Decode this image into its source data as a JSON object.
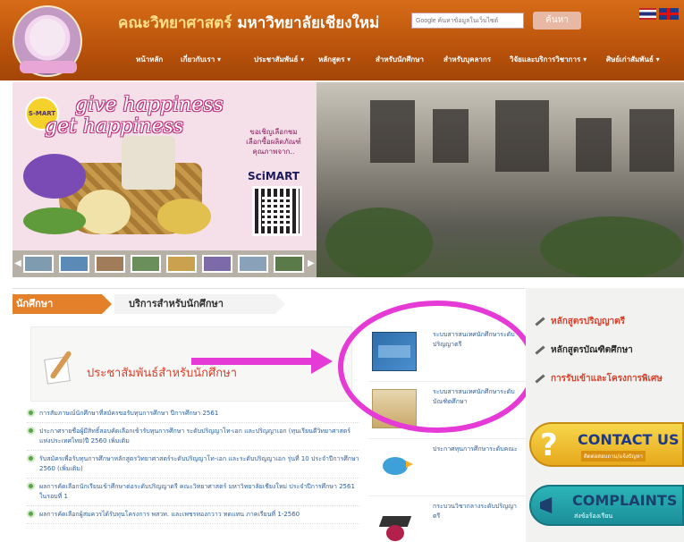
{
  "header": {
    "title_faculty": "คณะวิทยาศาสตร์",
    "title_university": "มหาวิทยาลัยเชียงใหม่",
    "search_placeholder": "Google ค้นหาข้อมูลในเว็บไซต์",
    "search_button": "ค้นหา",
    "nav": [
      {
        "label": "หน้าหลัก"
      },
      {
        "label": "เกี่ยวกับเรา ▾"
      },
      {
        "label": "ประชาสัมพันธ์ ▾"
      },
      {
        "label": "หลักสูตร ▾"
      },
      {
        "label": "สำหรับนักศึกษา"
      },
      {
        "label": "สำหรับบุคลากร"
      },
      {
        "label": "วิจัยและบริการวิชาการ ▾"
      },
      {
        "label": "ศิษย์เก่าสัมพันธ์ ▾"
      }
    ]
  },
  "banner": {
    "badge": "S-MART",
    "slogan_line1": "give happiness",
    "slogan_line2": "get happiness",
    "promo_copy": [
      "ขอเชิญเลือกชม",
      "เลือกซื้อผลิตภัณฑ์",
      "คุณภาพจาก.."
    ],
    "promo_brand": "SciMART"
  },
  "tabs": {
    "students": "นักศึกษา",
    "services": "บริการสำหรับนักศึกษา"
  },
  "pr": {
    "title": "ประชาสัมพันธ์สำหรับนักศึกษา"
  },
  "news": [
    "การสัมภาษณ์นักศึกษาที่สมัครขอรับทุนการศึกษา ปีการศึกษา 2561",
    "ประกาศรายชื่อผู้มีสิทธิ์สอบคัดเลือกเข้ารับทุนการศึกษา ระดับปริญญาโท-เอก และปริญญาเอก (ทุนเรียนดีวิทยาศาสตร์แห่งประเทศไทย)ปี 2560 เพิ่มเติม",
    "รับสมัครเพื่อรับทุนการศึกษาหลักสูตรวิทยาศาสตร์ระดับปริญญาโท-เอก และระดับปริญญาเอก รุ่นที่ 10 ประจำปีการศึกษา 2560 (เพิ่มเติม)",
    "ผลการคัดเลือกนักเรียนเข้าศึกษาต่อระดับปริญญาตรี คณะวิทยาศาสตร์ มหาวิทยาลัยเชียงใหม่ ประจำปีการศึกษา 2561 ในรอบที่ 1",
    "ผลการคัดเลือกผู้สมควรได้รับทุนโครงการ พสวท. และเพชรทองกวาว ทดแทน ภาคเรียนที่ 1-2560"
  ],
  "services": [
    {
      "label": "ระบบสารสนเทศนักศึกษาระดับปริญญาตรี"
    },
    {
      "label": "ระบบสารสนเทศนักศึกษาระดับบัณฑิตศึกษา"
    },
    {
      "label": "ประกาศทุนการศึกษาระดับคณะ"
    },
    {
      "label": "กระบวนวิชากลางระดับปริญญาตรี"
    }
  ],
  "sidebar": {
    "links": [
      {
        "label": "หลักสูตรปริญญาตรี",
        "color": "#d9402a"
      },
      {
        "label": "หลักสูตรบัณฑิตศึกษา",
        "color": "#2a2a2a"
      },
      {
        "label": "การรับเข้าและโครงการพิเศษ",
        "color": "#d9402a"
      }
    ],
    "contact": {
      "label": "CONTACT US",
      "sub": "ติดต่อสอบถาม/แจ้งปัญหา"
    },
    "complaints": {
      "label": "COMPLAINTS",
      "sub": "ส่งข้อร้องเรียน"
    }
  }
}
